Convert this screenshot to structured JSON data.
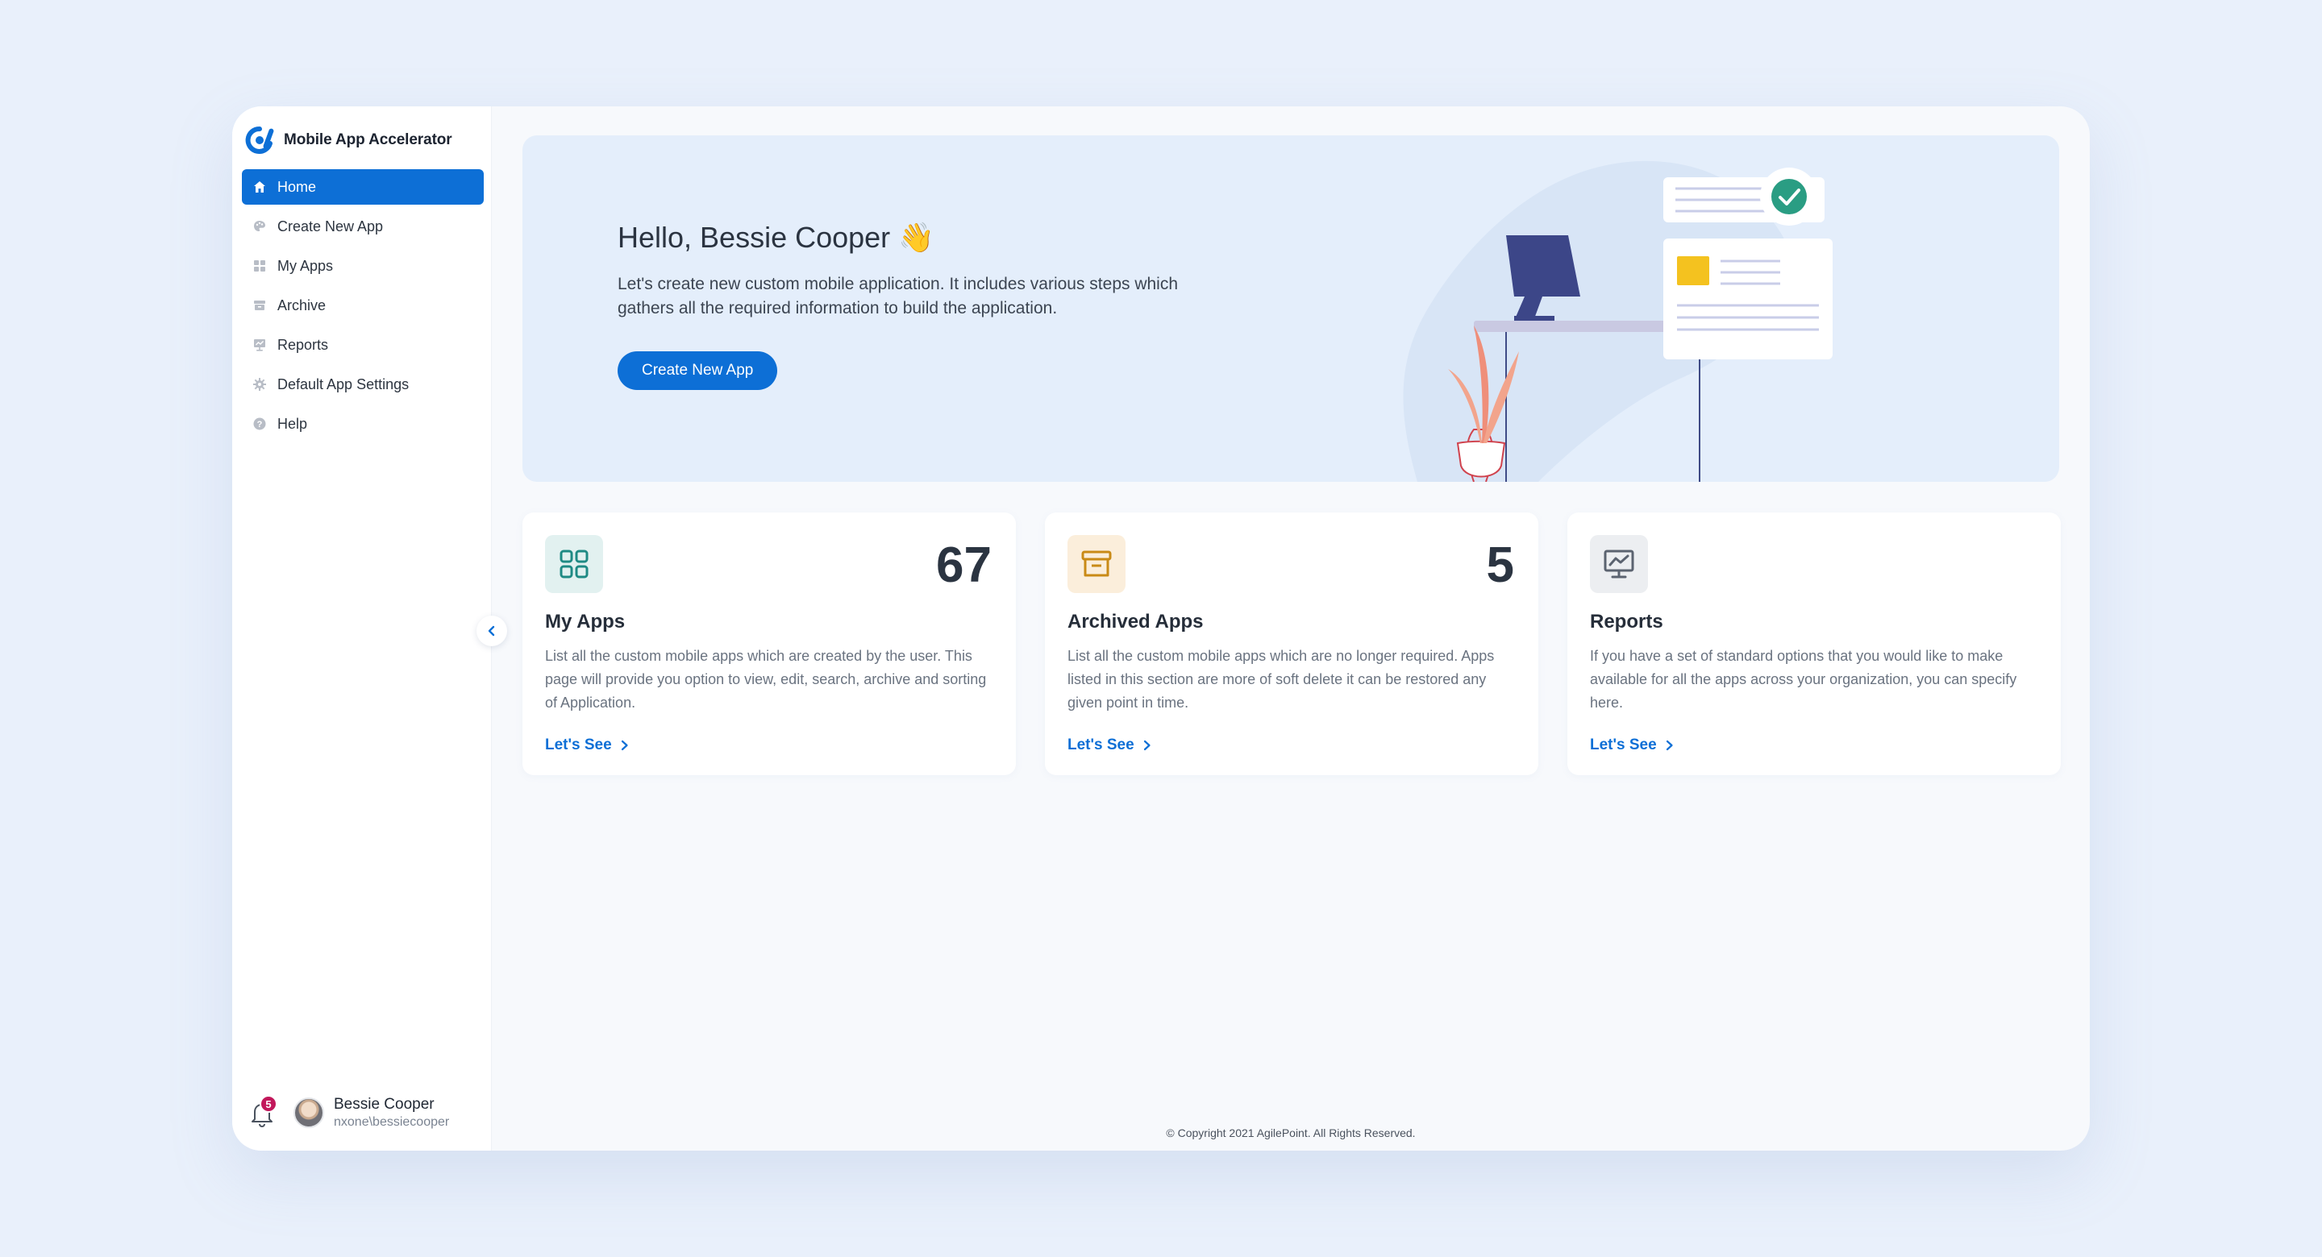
{
  "app": {
    "title": "Mobile App Accelerator",
    "brand_color": "#0d6fd6"
  },
  "sidebar": {
    "items": [
      {
        "label": "Home",
        "icon": "home-icon",
        "active": true
      },
      {
        "label": "Create New App",
        "icon": "palette-icon",
        "active": false
      },
      {
        "label": "My Apps",
        "icon": "grid-icon",
        "active": false
      },
      {
        "label": "Archive",
        "icon": "archive-icon",
        "active": false
      },
      {
        "label": "Reports",
        "icon": "reports-icon",
        "active": false
      },
      {
        "label": "Default App Settings",
        "icon": "gear-icon",
        "active": false
      },
      {
        "label": "Help",
        "icon": "help-icon",
        "active": false
      }
    ],
    "notifications_count": "5",
    "user": {
      "name": "Bessie Cooper",
      "login": "nxone\\bessiecooper"
    }
  },
  "hero": {
    "greeting": "Hello, Bessie Cooper 👋",
    "description": "Let's create new custom mobile application. It includes various steps which gathers all the required information to build the application.",
    "button_label": "Create New App"
  },
  "cards": [
    {
      "title": "My Apps",
      "count": "67",
      "icon": "grid-icon",
      "description": "List all the custom mobile apps which are created by the user. This page will provide you option to view, edit, search, archive and sorting of Application.",
      "link_label": "Let's See",
      "accent": "#1f8a84"
    },
    {
      "title": "Archived Apps",
      "count": "5",
      "icon": "archive-icon",
      "description": "List all the custom mobile apps which are no longer required. Apps listed in this section are more of soft delete it can be restored any given point in time.",
      "link_label": "Let's See",
      "accent": "#c98a16"
    },
    {
      "title": "Reports",
      "count": "",
      "icon": "reports-icon",
      "description": "If you have a set of standard options that you would like to make available for all the apps across your organization, you can specify here.",
      "link_label": "Let's See",
      "accent": "#5b6370"
    }
  ],
  "footer": {
    "copyright": "© Copyright 2021 AgilePoint. All Rights Reserved."
  }
}
